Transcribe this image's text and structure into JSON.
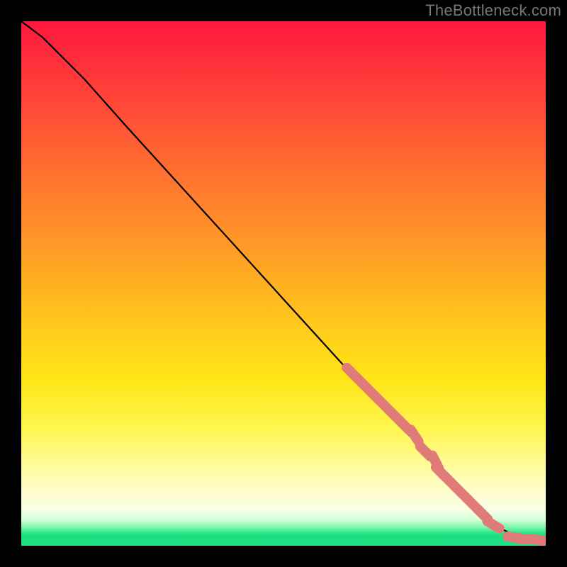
{
  "watermark": "TheBottleneck.com",
  "colors": {
    "background": "#000000",
    "curve": "#000000",
    "marker": "#e07b78",
    "gradient_top": "#ff173e",
    "gradient_mid": "#ffe516",
    "gradient_bottom": "#22e187"
  },
  "chart_data": {
    "type": "line",
    "title": "",
    "xlabel": "",
    "ylabel": "",
    "xlim": [
      0,
      100
    ],
    "ylim": [
      0,
      100
    ],
    "grid": false,
    "legend": false,
    "series": [
      {
        "name": "bottleneck-curve",
        "x": [
          0,
          4,
          8,
          12,
          20,
          30,
          40,
          50,
          60,
          70,
          75,
          80,
          85,
          88,
          90,
          92,
          94,
          96,
          98,
          100
        ],
        "y": [
          100,
          97,
          93,
          89,
          80,
          69,
          58,
          47,
          36,
          25,
          20,
          14,
          9,
          6,
          4,
          3,
          2,
          1.5,
          1.2,
          1
        ]
      }
    ],
    "highlight_points": {
      "name": "highlighted-range",
      "x": [
        63,
        65,
        67,
        69,
        71,
        73,
        75,
        77,
        79,
        80,
        82,
        84,
        86,
        88,
        90,
        94,
        96,
        99,
        100
      ],
      "y": [
        33,
        31,
        29,
        27,
        25,
        23,
        21,
        18,
        16,
        14,
        12,
        10,
        8,
        6,
        4,
        1.6,
        1.3,
        1.1,
        1
      ]
    }
  }
}
